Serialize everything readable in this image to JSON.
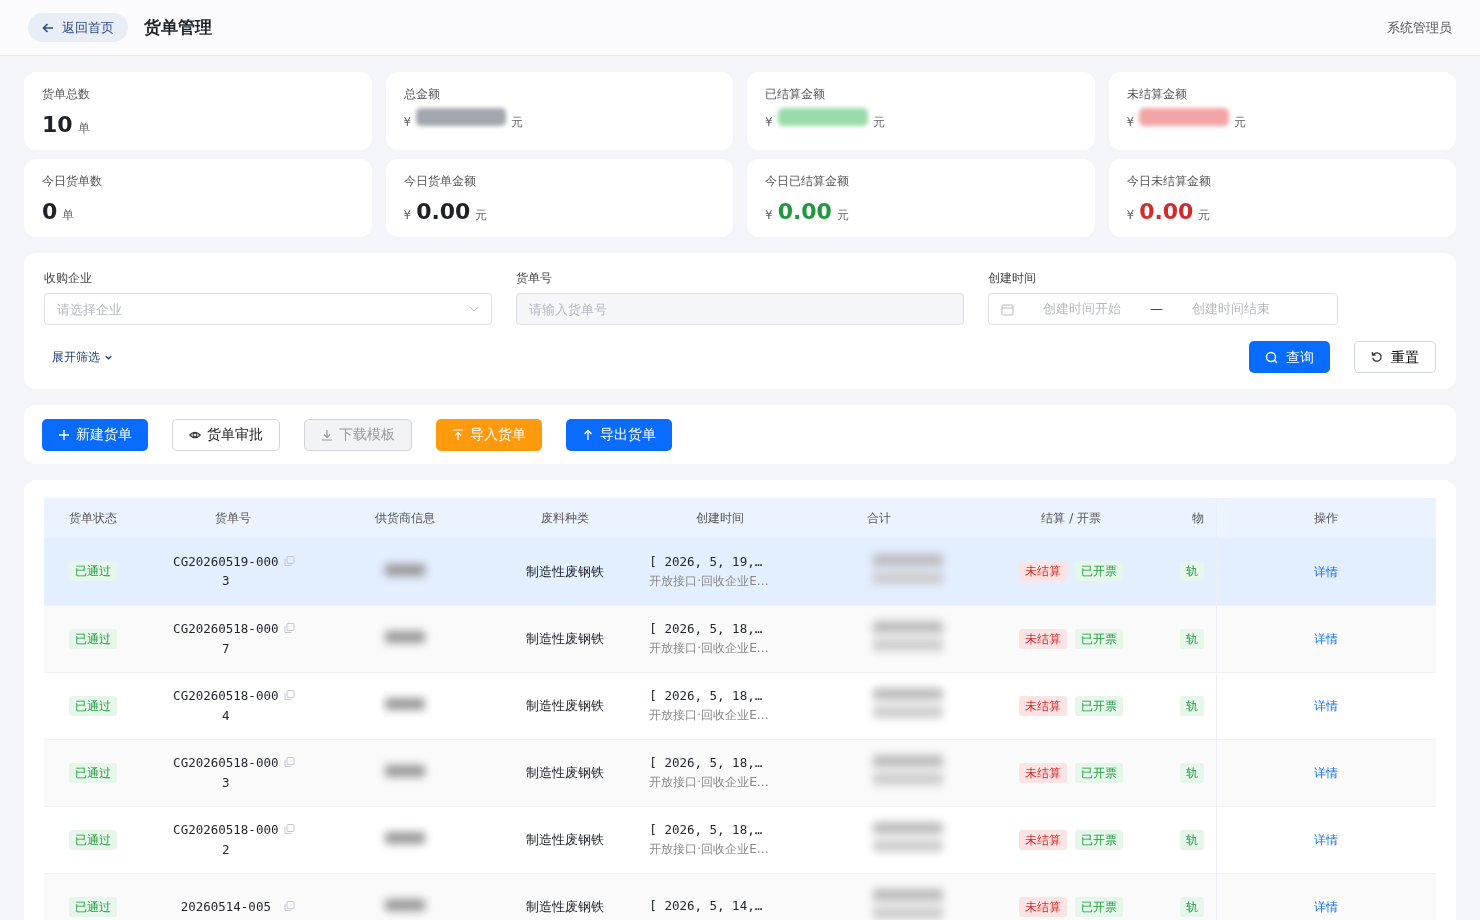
{
  "header": {
    "back_button": "返回首页",
    "title": "货单管理",
    "user": "系统管理员"
  },
  "stats": [
    {
      "label": "货单总数",
      "value": "10",
      "unit": "单",
      "color": "#1f2328"
    },
    {
      "label": "总金额",
      "prefix": "¥",
      "unit": "元",
      "color": "#a3a7ae",
      "blurred": true
    },
    {
      "label": "已结算金额",
      "prefix": "¥",
      "unit": "元",
      "color": "#9adbaa",
      "blurred": true
    },
    {
      "label": "未结算金额",
      "prefix": "¥",
      "unit": "元",
      "color": "#f3a5a5",
      "blurred": true
    },
    {
      "label": "今日货单数",
      "value": "0",
      "unit": "单",
      "color": "#1f2328"
    },
    {
      "label": "今日货单金额",
      "prefix": "¥",
      "value": "0.00",
      "unit": "元",
      "color": "#1f2328"
    },
    {
      "label": "今日已结算金额",
      "prefix": "¥",
      "value": "0.00",
      "unit": "元",
      "color": "#1e9a3c"
    },
    {
      "label": "今日未结算金额",
      "prefix": "¥",
      "value": "0.00",
      "unit": "元",
      "color": "#d12b2b"
    }
  ],
  "filters": {
    "company": {
      "label": "收购企业",
      "placeholder": "请选择企业"
    },
    "order_no": {
      "label": "货单号",
      "placeholder": "请输入货单号"
    },
    "created": {
      "label": "创建时间",
      "start_placeholder": "创建时间开始",
      "separator": "—",
      "end_placeholder": "创建时间结束"
    },
    "expand": "展开筛选",
    "search_button": "查询",
    "reset_button": "重置"
  },
  "toolbar": [
    {
      "label": "新建货单",
      "kind": "primary"
    },
    {
      "label": "货单审批",
      "kind": "outline"
    },
    {
      "label": "下载模板",
      "kind": "disabled"
    },
    {
      "label": "导入货单",
      "kind": "warning"
    },
    {
      "label": "导出货单",
      "kind": "primary"
    }
  ],
  "table": {
    "columns": [
      "货单状态",
      "货单号",
      "供货商信息",
      "废料种类",
      "创建时间",
      "合计",
      "结算 / 开票",
      "物",
      "操作"
    ],
    "rows": [
      {
        "selected": true,
        "status": "已通过",
        "number": "CG20260519-0003",
        "type": "制造性废钢铁",
        "time": "[ 2026, 5, 19,…",
        "source": "开放接口·回收企业E…",
        "settle": "未结算",
        "invoice": "已开票",
        "logistics": "轨",
        "action": "详情"
      },
      {
        "selected": false,
        "status": "已通过",
        "number": "CG20260518-0007",
        "type": "制造性废钢铁",
        "time": "[ 2026, 5, 18,…",
        "source": "开放接口·回收企业E…",
        "settle": "未结算",
        "invoice": "已开票",
        "logistics": "轨",
        "action": "详情"
      },
      {
        "selected": false,
        "status": "已通过",
        "number": "CG20260518-0004",
        "type": "制造性废钢铁",
        "time": "[ 2026, 5, 18,…",
        "source": "开放接口·回收企业E…",
        "settle": "未结算",
        "invoice": "已开票",
        "logistics": "轨",
        "action": "详情"
      },
      {
        "selected": false,
        "status": "已通过",
        "number": "CG20260518-0003",
        "type": "制造性废钢铁",
        "time": "[ 2026, 5, 18,…",
        "source": "开放接口·回收企业E…",
        "settle": "未结算",
        "invoice": "已开票",
        "logistics": "轨",
        "action": "详情"
      },
      {
        "selected": false,
        "status": "已通过",
        "number": "CG20260518-0002",
        "type": "制造性废钢铁",
        "time": "[ 2026, 5, 18,…",
        "source": "开放接口·回收企业E…",
        "settle": "未结算",
        "invoice": "已开票",
        "logistics": "轨",
        "action": "详情"
      },
      {
        "selected": false,
        "status": "已通过",
        "number": "20260514-005",
        "type": "制造性废钢铁",
        "time": "[ 2026, 5, 14,…",
        "settle": "未结算",
        "invoice": "已开票",
        "logistics": "轨",
        "action": "详情"
      }
    ]
  }
}
